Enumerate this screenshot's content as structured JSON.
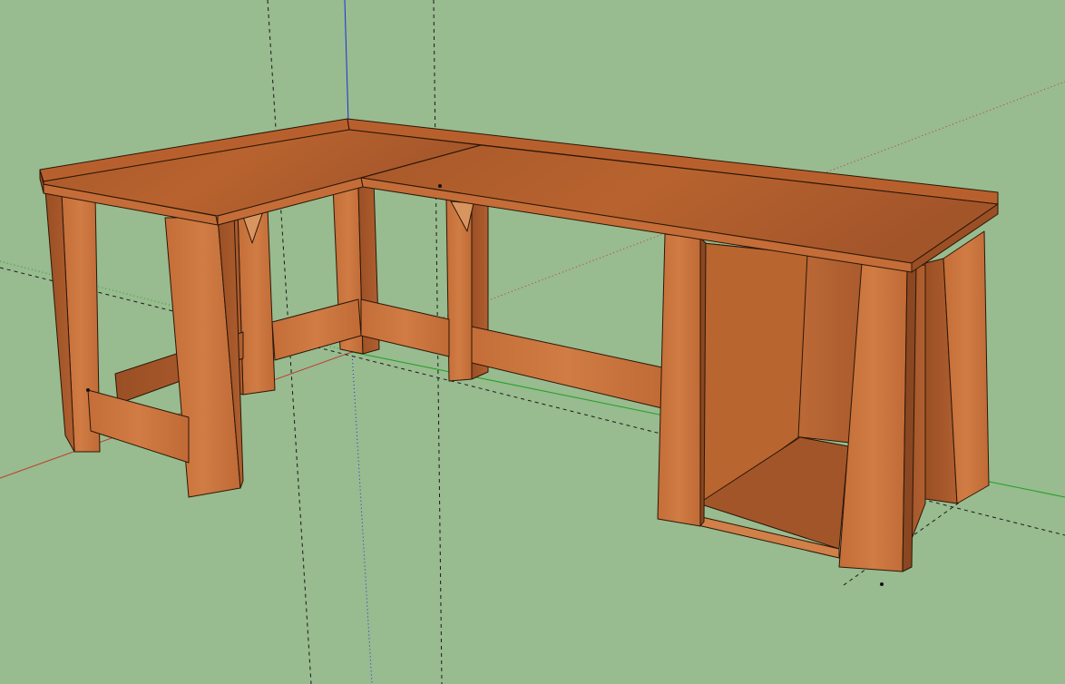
{
  "viewport": {
    "background": "#98bb8f",
    "tool": "orbit",
    "view": "perspective"
  },
  "axes": {
    "red": "#c0392b",
    "green": "#1fa01f",
    "blue": "#1c2fd8"
  },
  "model": {
    "name": "L-shaped desk",
    "material_light": "#c97844",
    "material_mid": "#ad5f2f",
    "material_dark": "#8a4722",
    "edge_color": "#2b1708"
  }
}
